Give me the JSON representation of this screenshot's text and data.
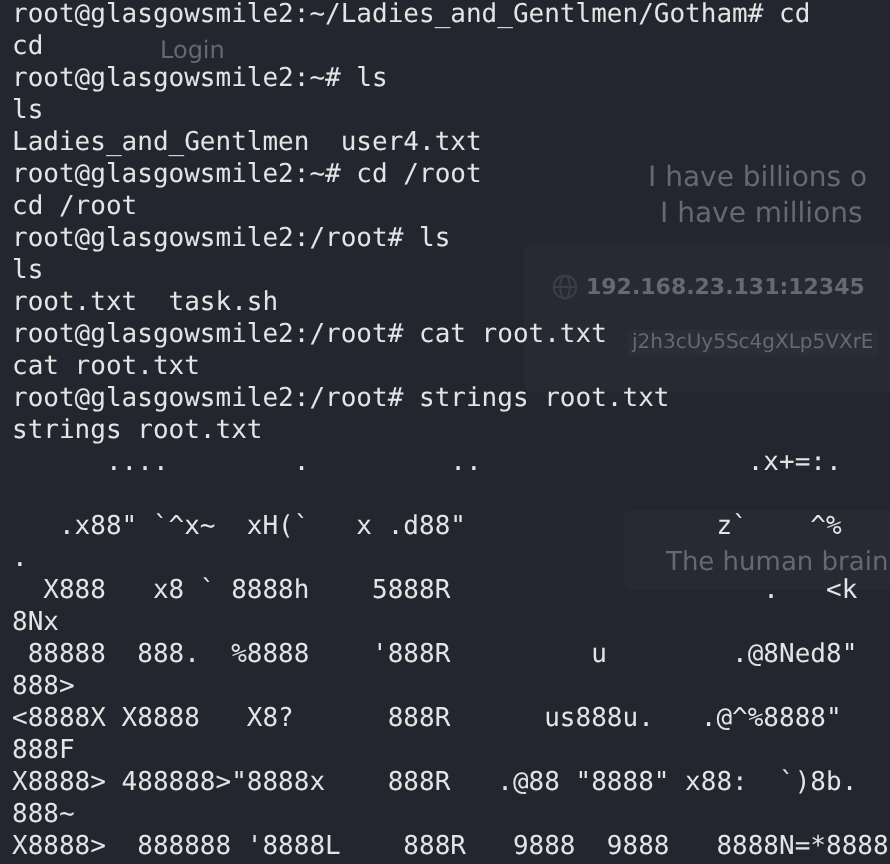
{
  "background_window": {
    "title": "Login",
    "quote_lines": [
      "I have billions o",
      "I have millions"
    ],
    "server_address": "192.168.23.131:12345",
    "token": "j2h3cUy5Sc4gXLp5VXrE",
    "panel_text": "The human brain"
  },
  "terminal": {
    "lines": [
      {
        "kind": "text",
        "text": "root@glasgowsmile2:~/Ladies_and_Gentlmen/Gotham# cd"
      },
      {
        "kind": "text",
        "text": "cd"
      },
      {
        "kind": "text",
        "text": "root@glasgowsmile2:~# ls"
      },
      {
        "kind": "text",
        "text": "ls"
      },
      {
        "kind": "text",
        "text": "Ladies_and_Gentlmen  user4.txt"
      },
      {
        "kind": "text",
        "text": "root@glasgowsmile2:~# cd /root"
      },
      {
        "kind": "text",
        "text": "cd /root"
      },
      {
        "kind": "text",
        "text": "root@glasgowsmile2:/root# ls"
      },
      {
        "kind": "text",
        "text": "ls"
      },
      {
        "kind": "text",
        "text": "root.txt  task.sh"
      },
      {
        "kind": "text",
        "text": "root@glasgowsmile2:/root# cat root.txt"
      },
      {
        "kind": "text",
        "text": "cat root.txt"
      },
      {
        "kind": "text",
        "text": "root@glasgowsmile2:/root# strings root.txt"
      },
      {
        "kind": "text",
        "text": "strings root.txt"
      },
      {
        "kind": "text",
        "text": "      ....        .         ..                 .x+=:."
      },
      {
        "kind": "blank"
      },
      {
        "kind": "text",
        "text": "   .x88\" `^x~  xH(`   x .d88\"                z`    ^%"
      },
      {
        "kind": "text",
        "text": "."
      },
      {
        "kind": "text",
        "text": "  X888   x8 ` 8888h    5888R                    .   <k"
      },
      {
        "kind": "text",
        "text": "8Nx"
      },
      {
        "kind": "text",
        "text": " 88888  888.  %8888    '888R         u        .@8Ned8\""
      },
      {
        "kind": "text",
        "text": "888>"
      },
      {
        "kind": "text",
        "text": "<8888X X8888   X8?      888R      us888u.   .@^%8888\""
      },
      {
        "kind": "text",
        "text": "888F"
      },
      {
        "kind": "text",
        "text": "X8888> 488888>\"8888x    888R   .@88 \"8888\" x88:  `)8b."
      },
      {
        "kind": "text",
        "text": "888~"
      },
      {
        "kind": "text",
        "text": "X8888>  888888 '8888L    888R   9888  9888   8888N=*8888"
      }
    ]
  }
}
